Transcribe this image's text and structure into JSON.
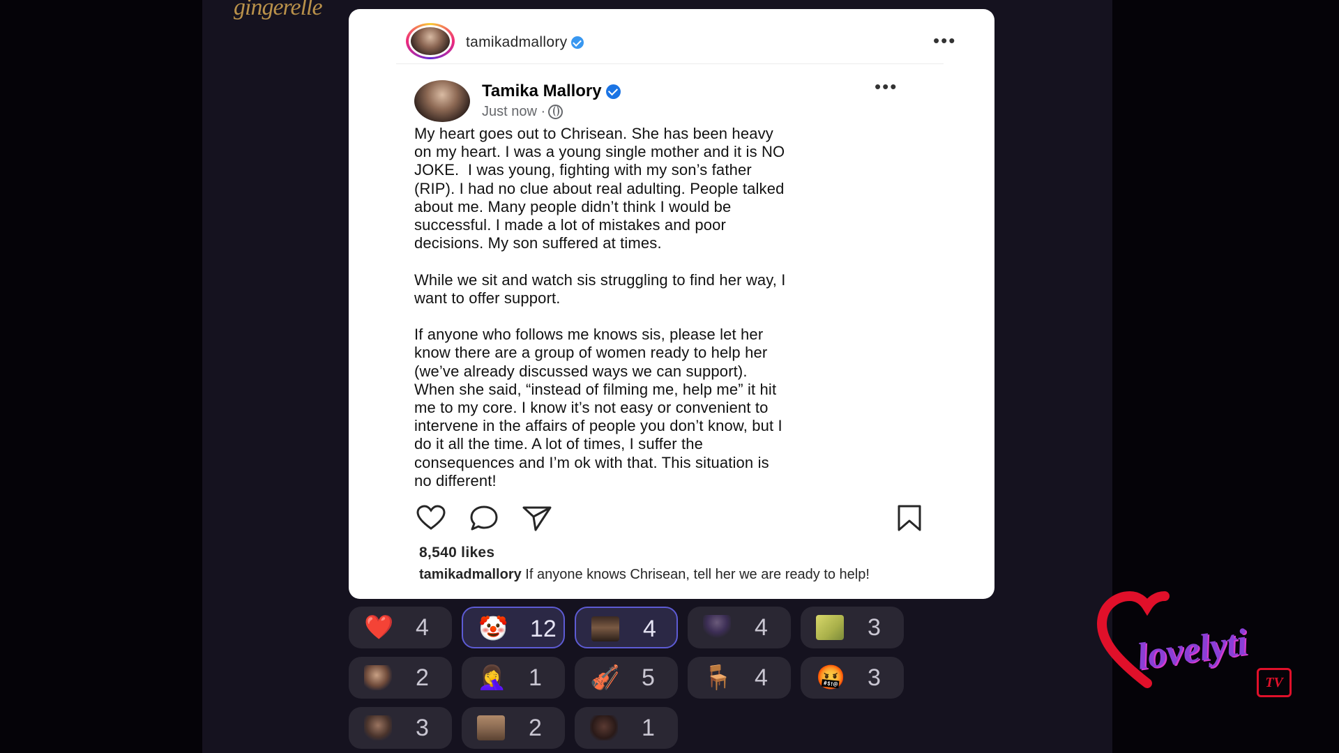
{
  "top_logo": "gingerelle",
  "post": {
    "username": "tamikadmallory",
    "author_name": "Tamika Mallory",
    "timestamp": "Just now ·",
    "body": "My heart goes out to Chrisean. She has been heavy\non my heart. I was a young single mother and it is NO\nJOKE.  I was young, fighting with my son’s father\n(RIP). I had no clue about real adulting. People talked\nabout me. Many people didn’t think I would be\nsuccessful. I made a lot of mistakes and poor\ndecisions. My son suffered at times.\n\nWhile we sit and watch sis struggling to find her way, I\nwant to offer support.\n\nIf anyone who follows me knows sis, please let her\nknow there are a group of women ready to help her\n(we’ve already discussed ways we can support).\nWhen she said, “instead of filming me, help me” it hit\nme to my core. I know it’s not easy or convenient to\nintervene in the affairs of people you don’t know, but I\ndo it all the time. A lot of times, I suffer the\nconsequences and I’m ok with that. This situation is\nno different!",
    "likes": "8,540 likes",
    "caption_user": "tamikadmallory",
    "caption_text": " If anyone knows Chrisean, tell her we are ready to help!"
  },
  "icons": {
    "ig_more": "more-dots-icon",
    "fb_more": "more-dots-icon",
    "like": "heart-outline-icon",
    "comment": "comment-bubble-icon",
    "share": "paper-plane-icon",
    "save": "bookmark-icon",
    "globe": "globe-icon",
    "verified": "verified-badge-icon"
  },
  "reactions": [
    {
      "emoji": "❤️",
      "count": "4",
      "selected": false
    },
    {
      "emoji": "🤡",
      "count": "12",
      "selected": true
    },
    {
      "emoji": "",
      "count": "4",
      "selected": true
    },
    {
      "emoji": "",
      "count": "4",
      "selected": false
    },
    {
      "emoji": "",
      "count": "3",
      "selected": false
    },
    {
      "emoji": "",
      "count": "2",
      "selected": false
    },
    {
      "emoji": "🤦‍♀️",
      "count": "1",
      "selected": false
    },
    {
      "emoji": "🎻",
      "count": "5",
      "selected": false
    },
    {
      "emoji": "🪑",
      "count": "4",
      "selected": false
    },
    {
      "emoji": "🤬",
      "count": "3",
      "selected": false
    },
    {
      "emoji": "",
      "count": "3",
      "selected": false
    },
    {
      "emoji": "",
      "count": "2",
      "selected": false
    },
    {
      "emoji": "",
      "count": "1",
      "selected": false
    }
  ],
  "watermark": "lovelyti",
  "colors": {
    "verified_ig": "#3897f0",
    "verified_fb": "#1b74e4",
    "reaction_selected_border": "#5d5bd4",
    "watermark": "#8a3fd6"
  }
}
